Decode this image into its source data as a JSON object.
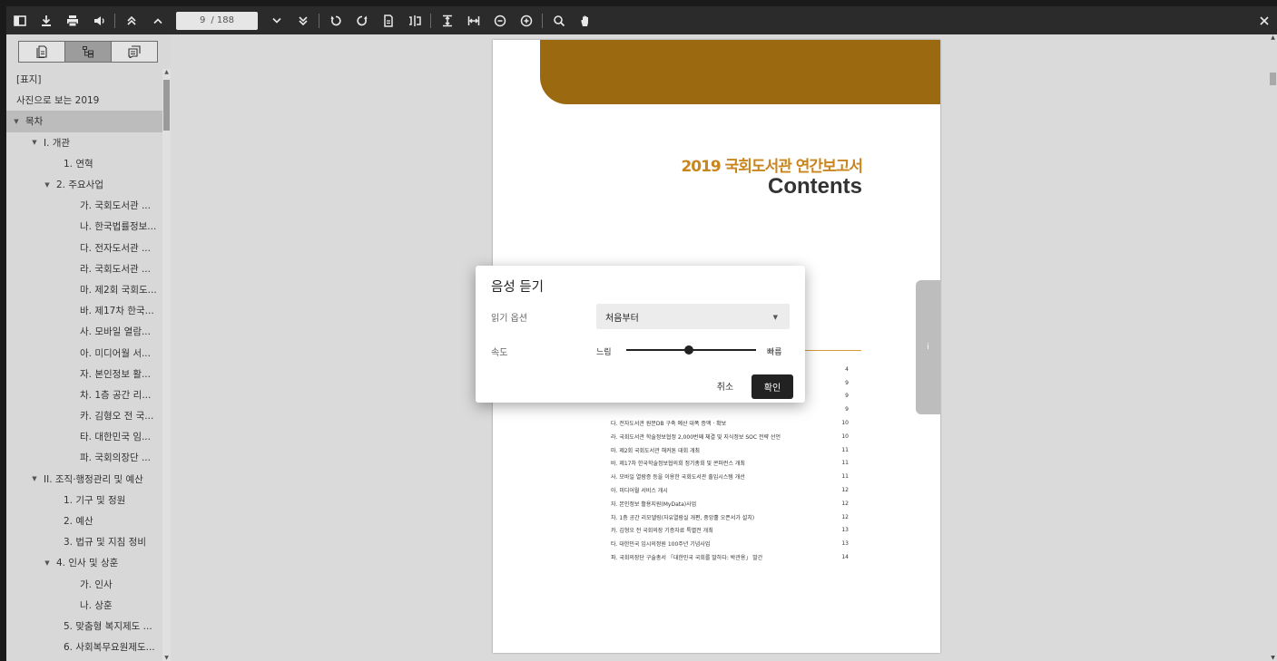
{
  "toolbar": {
    "page_current": "9",
    "page_total": "/ 188"
  },
  "sidebar": {
    "tabs": [
      "thumbnail-tab",
      "outline-tab",
      "annotation-tab"
    ],
    "items": [
      {
        "label": "[표지]",
        "level": 0,
        "toggle": ""
      },
      {
        "label": "사진으로 보는 2019",
        "level": 0,
        "toggle": ""
      },
      {
        "label": "목차",
        "level": 0,
        "toggle": "▼"
      },
      {
        "label": "I. 개관",
        "level": 1,
        "toggle": "▼"
      },
      {
        "label": "1. 연혁",
        "level": 3,
        "toggle": ""
      },
      {
        "label": "2. 주요사업",
        "level": 2,
        "toggle": "▼"
      },
      {
        "label": "가. 국회도서관 ...",
        "level": 4,
        "toggle": ""
      },
      {
        "label": "나. 한국법률정보...",
        "level": 4,
        "toggle": ""
      },
      {
        "label": "다. 전자도서관 ...",
        "level": 4,
        "toggle": ""
      },
      {
        "label": "라. 국회도서관 ...",
        "level": 4,
        "toggle": ""
      },
      {
        "label": "마. 제2회 국회도...",
        "level": 4,
        "toggle": ""
      },
      {
        "label": "바. 제17차 한국...",
        "level": 4,
        "toggle": ""
      },
      {
        "label": "사. 모바일 열람...",
        "level": 4,
        "toggle": ""
      },
      {
        "label": "아. 미디어월 서...",
        "level": 4,
        "toggle": ""
      },
      {
        "label": "자. 본인정보 활...",
        "level": 4,
        "toggle": ""
      },
      {
        "label": "차. 1층 공간 리...",
        "level": 4,
        "toggle": ""
      },
      {
        "label": "카. 김형오 전 국...",
        "level": 4,
        "toggle": ""
      },
      {
        "label": "타. 대한민국 임...",
        "level": 4,
        "toggle": ""
      },
      {
        "label": "파. 국회의장단 ...",
        "level": 4,
        "toggle": ""
      },
      {
        "label": "II. 조직·행정관리 및 예산",
        "level": 1,
        "toggle": "▼"
      },
      {
        "label": "1. 기구 및 정원",
        "level": 3,
        "toggle": ""
      },
      {
        "label": "2. 예산",
        "level": 3,
        "toggle": ""
      },
      {
        "label": "3. 법규 및 지침 정비",
        "level": 3,
        "toggle": ""
      },
      {
        "label": "4. 인사 및 상훈",
        "level": 2,
        "toggle": "▼"
      },
      {
        "label": "가. 인사",
        "level": 4,
        "toggle": ""
      },
      {
        "label": "나. 상훈",
        "level": 4,
        "toggle": ""
      },
      {
        "label": "5. 맞춤형 복지제도 ...",
        "level": 3,
        "toggle": ""
      },
      {
        "label": "6. 사회복무요원제도...",
        "level": 3,
        "toggle": ""
      }
    ]
  },
  "document": {
    "title": "2019 국회도서관 연간보고서",
    "subtitle": "Contents",
    "toc": [
      {
        "text": "",
        "page": "4"
      },
      {
        "text": "",
        "page": "9"
      },
      {
        "text": "",
        "page": "9"
      },
      {
        "text": "",
        "page": "9"
      },
      {
        "text": "다. 전자도서관 원문DB 구축 예산 대폭 증액 · 확보",
        "page": "10"
      },
      {
        "text": "라. 국회도서관 학술정보협정 2,000번째 체결 및 지식정보 SOC 전략 선언",
        "page": "10"
      },
      {
        "text": "마. 제2회 국회도서관 해커톤 대회 개최",
        "page": "11"
      },
      {
        "text": "바. 제17차 한국학술정보협의회 정기총회 및 콘퍼런스 개최",
        "page": "11"
      },
      {
        "text": "사. 모바일 열람증 등을 이용한 국회도서관 출입시스템 개선",
        "page": "11"
      },
      {
        "text": "아. 미디어월 서비스 개시",
        "page": "12"
      },
      {
        "text": "자. 본인정보 활용지원(MyData)사업",
        "page": "12"
      },
      {
        "text": "차. 1층 공간 리모델링(자유열람실 개편, 중앙홀 오픈서가 설치)",
        "page": "12"
      },
      {
        "text": "카. 김형오 전 국회의장 기증자료 특별전 개최",
        "page": "13"
      },
      {
        "text": "타. 대한민국 임시의정원 100주년 기념사업",
        "page": "13"
      },
      {
        "text": "파. 국회의장단 구술총서 「대한민국 국회를 말하다: 박관용」 발간",
        "page": "14"
      }
    ]
  },
  "dialog": {
    "title": "음성 듣기",
    "read_option_label": "읽기 옵션",
    "read_option_value": "처음부터",
    "speed_label": "속도",
    "slow_label": "느림",
    "fast_label": "빠름",
    "speed_fraction": 0.48,
    "cancel_label": "취소",
    "ok_label": "확인"
  },
  "right_tab": {
    "label": "i"
  }
}
